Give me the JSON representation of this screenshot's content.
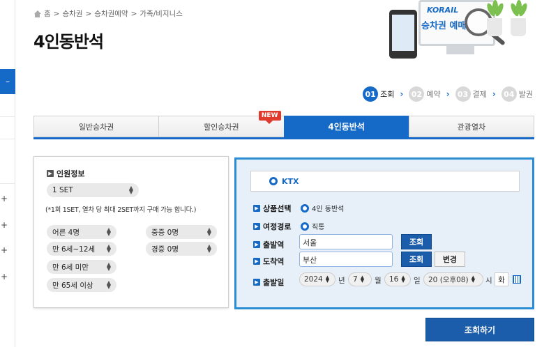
{
  "breadcrumb": [
    "홈",
    ">",
    "승차권",
    ">",
    "승차권예약",
    ">",
    "가족/비지니스"
  ],
  "page_title": "4인동반석",
  "promo": {
    "brand": "KORAIL",
    "text": "승차권 예매"
  },
  "steps": [
    {
      "num": "01",
      "label": "조회",
      "active": true
    },
    {
      "num": "02",
      "label": "예약",
      "active": false
    },
    {
      "num": "03",
      "label": "결제",
      "active": false
    },
    {
      "num": "04",
      "label": "발권",
      "active": false
    }
  ],
  "tabs": [
    {
      "label": "일반승차권",
      "active": false
    },
    {
      "label": "할인승차권",
      "active": false,
      "badge": "NEW"
    },
    {
      "label": "4인동반석",
      "active": true
    },
    {
      "label": "관광열차",
      "active": false
    }
  ],
  "passenger": {
    "heading": "인원정보",
    "set_value": "1 SET",
    "note": "(*1회 1SET, 열차 당 최대 2SET까지 구매 가능 합니다.)",
    "selects": [
      {
        "value": "어른 4명"
      },
      {
        "value": "중증 0명"
      },
      {
        "value": "만 6세~12세"
      },
      {
        "value": "경증 0명"
      },
      {
        "value": "만 6세 미만"
      },
      {
        "value": "만 65세 이상"
      }
    ]
  },
  "search": {
    "train_type": "KTX",
    "product_label": "상품선택",
    "product_value": "4인 동반석",
    "route_label": "여정경로",
    "route_value": "직통",
    "departure_label": "출발역",
    "departure_value": "서울",
    "arrival_label": "도착역",
    "arrival_value": "부산",
    "lookup_button": "조회",
    "change_button": "변경",
    "date_label": "출발일",
    "year": "2024",
    "year_unit": "년",
    "month": "7",
    "month_unit": "월",
    "day": "16",
    "day_unit": "일",
    "hour": "20 (오후08)",
    "hour_unit": "시",
    "weekday": "화"
  },
  "submit_label": "조회하기",
  "colors": {
    "primary": "#1569c7",
    "button": "#1c5dab",
    "panel_border": "#2a8dd4",
    "badge": "#e03a2f"
  }
}
